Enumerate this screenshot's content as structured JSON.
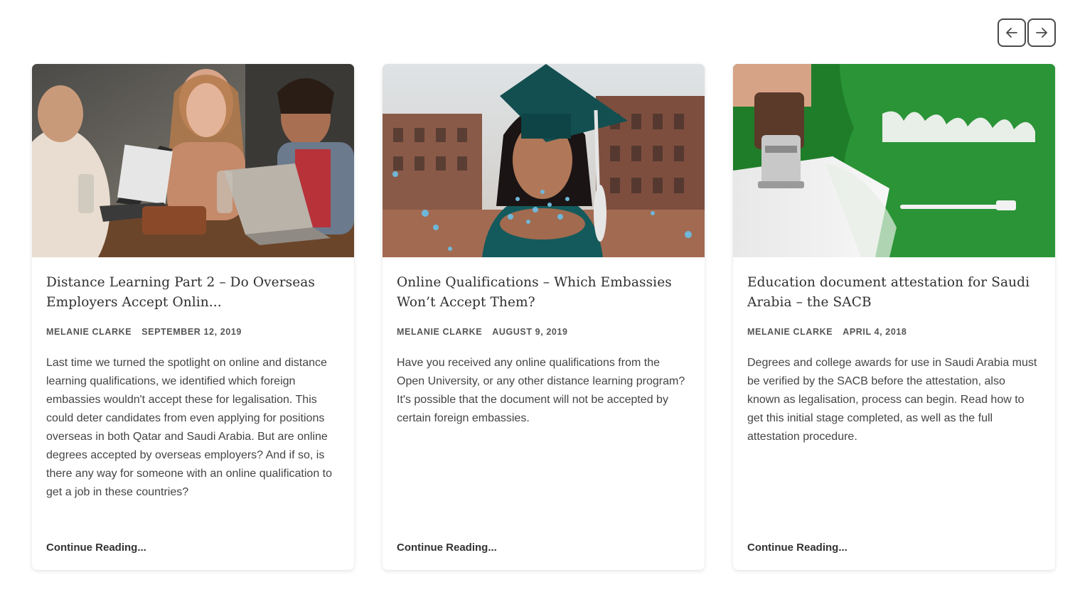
{
  "navigation": {
    "prev_icon": "arrow-left-icon",
    "next_icon": "arrow-right-icon"
  },
  "posts": [
    {
      "image": "students-laptops-photo",
      "title": "Distance Learning Part 2 – Do Overseas Employers Accept Onlin...",
      "author": "MELANIE CLARKE",
      "date": "SEPTEMBER 12, 2019",
      "excerpt": "Last time we turned the spotlight on online and distance learning qualifications, we identified which foreign embassies wouldn't accept these for legalisation. This could deter candidates from even applying for positions overseas in both Qatar and Saudi Arabia. But are online degrees accepted by overseas employers? And if so, is there any way for someone with an online qualification to get a job in these countries?",
      "more_label": "Continue Reading..."
    },
    {
      "image": "graduate-confetti-photo",
      "title": "Online Qualifications – Which Embassies Won’t Accept Them?",
      "author": "MELANIE CLARKE",
      "date": "AUGUST 9, 2019",
      "excerpt": "Have you received any online qualifications from the Open University, or any other distance learning program? It's possible that the document will not be accepted by certain foreign embassies.",
      "more_label": "Continue Reading..."
    },
    {
      "image": "saudi-flag-stamp-photo",
      "title": "Education document attestation for Saudi Arabia – the SACB",
      "author": "MELANIE CLARKE",
      "date": "APRIL 4, 2018",
      "excerpt": "Degrees and college awards for use in Saudi Arabia must be verified by the SACB before the attestation, also known as legalisation, process can begin. Read how to get this initial stage completed, as well as the full attestation procedure.",
      "more_label": "Continue Reading..."
    }
  ]
}
